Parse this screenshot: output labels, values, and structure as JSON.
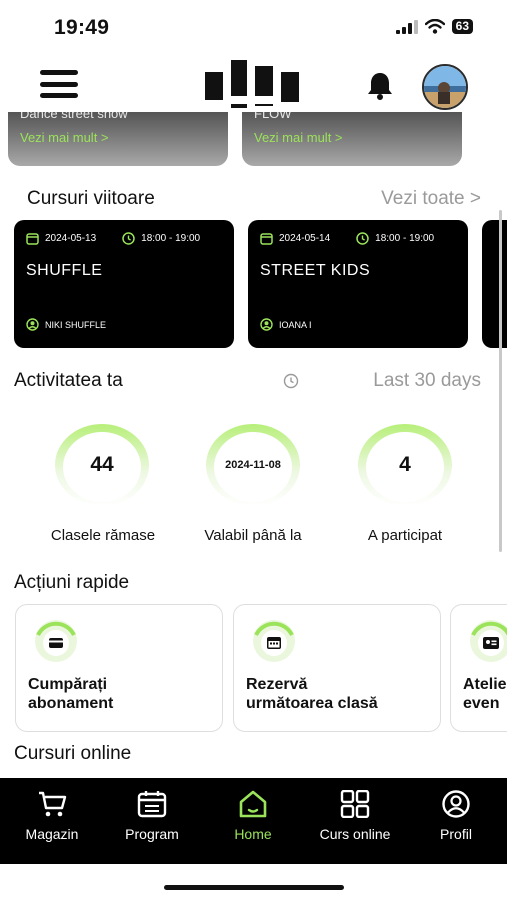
{
  "status_bar": {
    "time": "19:49",
    "battery": "63"
  },
  "feature_cards": [
    {
      "title": "Dance street show",
      "link": "Vezi mai mult >"
    },
    {
      "title": "FLOW",
      "link": "Vezi mai mult >"
    }
  ],
  "upcoming": {
    "title": "Cursuri viitoare",
    "see_all": "Vezi toate >",
    "courses": [
      {
        "date": "2024-05-13",
        "time": "18:00 - 19:00",
        "name": "SHUFFLE",
        "teacher": "NIKI SHUFFLE"
      },
      {
        "date": "2024-05-14",
        "time": "18:00 - 19:00",
        "name": "STREET KIDS",
        "teacher": "IOANA I"
      }
    ]
  },
  "activity": {
    "title": "Activitatea ta",
    "period": "Last 30 days",
    "stats": [
      {
        "value": "44",
        "label": "Clasele rămase"
      },
      {
        "value": "2024-11-08",
        "label": "Valabil până la"
      },
      {
        "value": "4",
        "label": "A participat"
      }
    ]
  },
  "quick_actions": {
    "title": "Acțiuni rapide",
    "items": [
      {
        "line1": "Cumpărați",
        "line2": "abonament",
        "icon": "card-icon"
      },
      {
        "line1": "Rezervă",
        "line2": "următoarea clasă",
        "icon": "calendar-icon"
      },
      {
        "line1": "Atelie",
        "line2": "even",
        "icon": "id-card-icon"
      }
    ]
  },
  "online": {
    "title": "Cursuri online"
  },
  "tabs": [
    {
      "label": "Magazin",
      "icon": "cart-icon"
    },
    {
      "label": "Program",
      "icon": "calendar-icon"
    },
    {
      "label": "Home",
      "icon": "home-icon",
      "active": true
    },
    {
      "label": "Curs online",
      "icon": "grid-icon"
    },
    {
      "label": "Profil",
      "icon": "profile-icon"
    }
  ],
  "colors": {
    "accent": "#9be35a",
    "dark": "#000000",
    "muted": "#9a9a9a"
  }
}
